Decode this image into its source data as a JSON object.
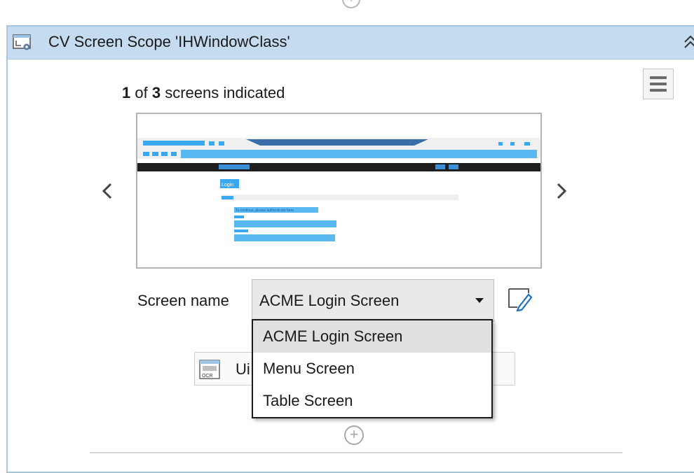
{
  "icons": {
    "add": "+",
    "collapse": "chevron-double-up-icon",
    "menu": "hamburger-icon",
    "prev": "‹",
    "next": "›"
  },
  "scope": {
    "title": "CV Screen Scope 'IHWindowClass'"
  },
  "indicator": {
    "current": "1",
    "of_text": " of ",
    "total": "3",
    "suffix": " screens indicated"
  },
  "preview": {
    "login_label": "Login",
    "message": "To continue, please authenticate here"
  },
  "screen_name": {
    "label": "Screen name",
    "value": "ACME Login Screen",
    "options": [
      "ACME Login Screen",
      "Menu Screen",
      "Table Screen"
    ]
  },
  "ocr": {
    "icon_label": "OCR",
    "partial_text": "Ui"
  },
  "colors": {
    "header_bg": "#c5dcf0",
    "header_border": "#a8c6df",
    "preview_accent": "#3aa8f0",
    "preview_dark": "#1e1e1e"
  }
}
